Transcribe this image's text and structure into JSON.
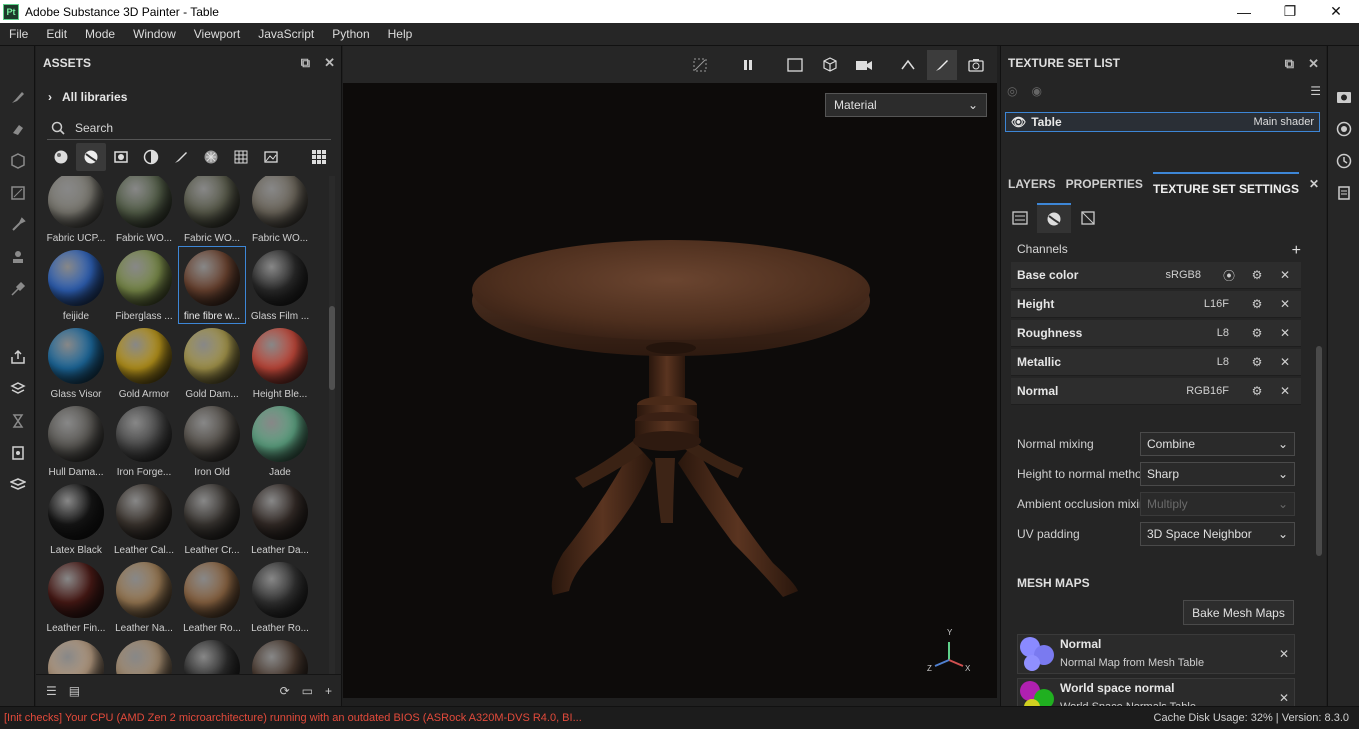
{
  "app": {
    "icon_text": "Pt",
    "title": "Adobe Substance 3D Painter - Table"
  },
  "window_buttons": {
    "minimize": "—",
    "maximize": "❐",
    "close": "✕"
  },
  "menu": [
    "File",
    "Edit",
    "Mode",
    "Window",
    "Viewport",
    "JavaScript",
    "Python",
    "Help"
  ],
  "assets": {
    "title": "ASSETS",
    "all_libraries": "All libraries",
    "search_placeholder": "Search",
    "items": [
      {
        "label": "Fabric UCP...",
        "color": "#7c7a72"
      },
      {
        "label": "Fabric WO...",
        "color": "#55604a"
      },
      {
        "label": "Fabric WO...",
        "color": "#5a5c4c"
      },
      {
        "label": "Fabric WO...",
        "color": "#6d675c"
      },
      {
        "label": "feijide",
        "color": "#2f62b8"
      },
      {
        "label": "Fiberglass ...",
        "color": "#7a8b4a"
      },
      {
        "label": "fine fibre w...",
        "color": "#6b4330"
      },
      {
        "label": "Glass Film ...",
        "color": "#2b2b2b"
      },
      {
        "label": "Glass Visor",
        "color": "#1d6a9e"
      },
      {
        "label": "Gold Armor",
        "color": "#b8951c"
      },
      {
        "label": "Gold Dam...",
        "color": "#a6974c"
      },
      {
        "label": "Height Ble...",
        "color": "#c2483a"
      },
      {
        "label": "Hull Dama...",
        "color": "#5c5a56"
      },
      {
        "label": "Iron Forge...",
        "color": "#4a4a4a"
      },
      {
        "label": "Iron Old",
        "color": "#55504a"
      },
      {
        "label": "Jade",
        "color": "#5ea483"
      },
      {
        "label": "Latex Black",
        "color": "#161616"
      },
      {
        "label": "Leather Cal...",
        "color": "#3d3630"
      },
      {
        "label": "Leather Cr...",
        "color": "#3a3632"
      },
      {
        "label": "Leather Da...",
        "color": "#352c28"
      },
      {
        "label": "Leather Fin...",
        "color": "#4a1a16"
      },
      {
        "label": "Leather Na...",
        "color": "#9a7a54"
      },
      {
        "label": "Leather Ro...",
        "color": "#8a6442"
      },
      {
        "label": "Leather Ro...",
        "color": "#333333"
      },
      {
        "label": "",
        "color": "#b49a80"
      },
      {
        "label": "",
        "color": "#a48c70"
      },
      {
        "label": "",
        "color": "#2e2e2e"
      },
      {
        "label": "",
        "color": "#4a3a30"
      }
    ]
  },
  "viewport": {
    "mode_select": "Material",
    "axis": {
      "y": "Y",
      "x": "X",
      "z": "Z"
    }
  },
  "texture_set_list": {
    "title": "TEXTURE SET LIST",
    "set_name": "Table",
    "shader": "Main shader"
  },
  "tabs": [
    "LAYERS",
    "PROPERTIES",
    "TEXTURE SET SETTINGS"
  ],
  "texture_set_settings": {
    "channels_label": "Channels",
    "channels": [
      {
        "name": "Base color",
        "format": "sRGB8"
      },
      {
        "name": "Height",
        "format": "L16F"
      },
      {
        "name": "Roughness",
        "format": "L8"
      },
      {
        "name": "Metallic",
        "format": "L8"
      },
      {
        "name": "Normal",
        "format": "RGB16F"
      }
    ],
    "properties": [
      {
        "label": "Normal mixing",
        "value": "Combine",
        "disabled": false
      },
      {
        "label": "Height to normal method",
        "value": "Sharp",
        "disabled": false
      },
      {
        "label": "Ambient occlusion mixing",
        "value": "Multiply",
        "disabled": true
      },
      {
        "label": "UV padding",
        "value": "3D Space Neighbor",
        "disabled": false
      }
    ],
    "mesh_maps_label": "MESH MAPS",
    "bake_button": "Bake Mesh Maps",
    "mesh_maps": [
      {
        "title": "Normal",
        "subtitle": "Normal Map from Mesh Table"
      },
      {
        "title": "World space normal",
        "subtitle": "World Space Normals Table"
      }
    ]
  },
  "status": {
    "message": "[Init checks] Your CPU (AMD Zen 2 microarchitecture) running with an outdated BIOS (ASRock A320M-DVS R4.0, BI...",
    "cache": "Cache Disk Usage:   32% | Version: 8.3.0"
  }
}
